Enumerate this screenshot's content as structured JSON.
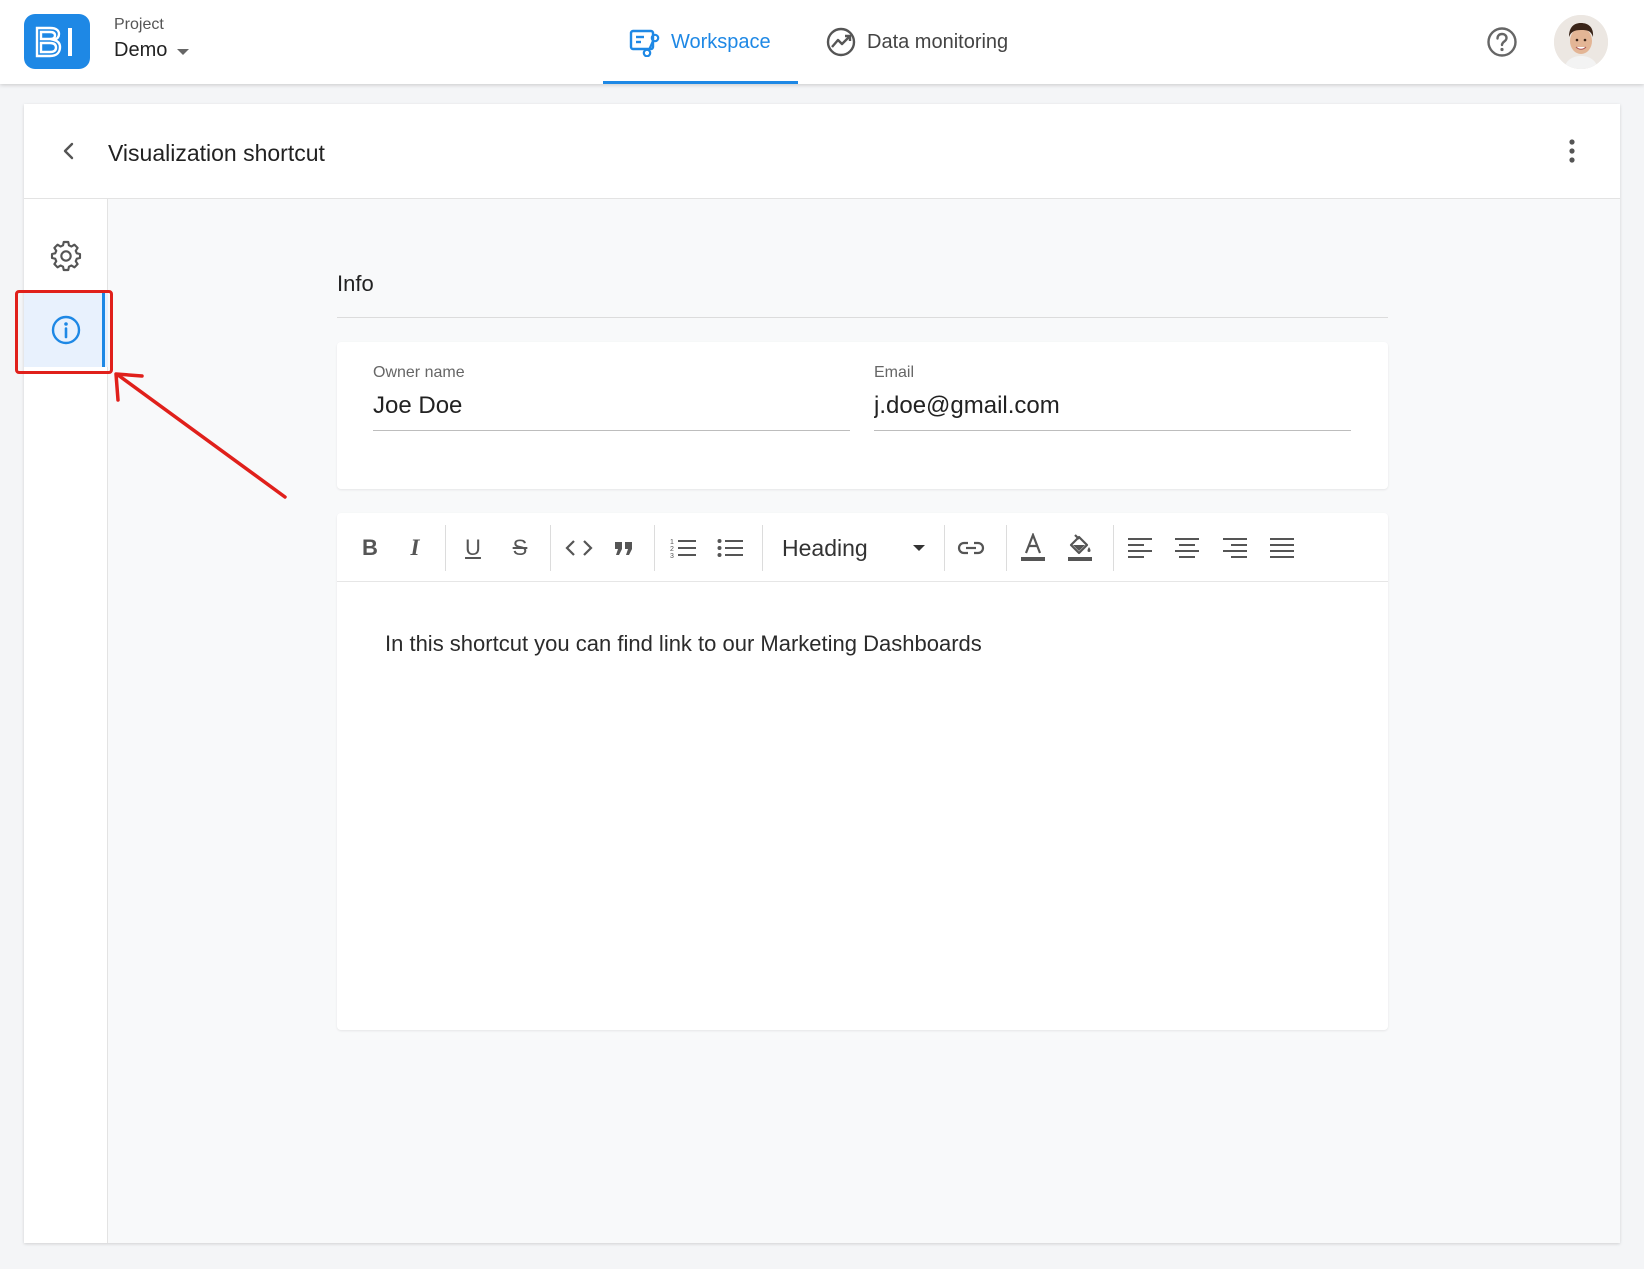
{
  "topbar": {
    "logo_text": "BI",
    "project_label": "Project",
    "project_name": "Demo",
    "tabs": [
      {
        "label": "Workspace",
        "active": true,
        "icon": "workspace-icon"
      },
      {
        "label": "Data monitoring",
        "active": false,
        "icon": "monitoring-chart-icon"
      }
    ],
    "help_icon": "help-circle-icon",
    "avatar_icon": "user-avatar"
  },
  "page": {
    "title": "Visualization shortcut",
    "back_icon": "chevron-left-icon",
    "menu_icon": "more-vertical-icon"
  },
  "sidebar": {
    "items": [
      {
        "name": "settings",
        "icon": "gear-icon",
        "active": false
      },
      {
        "name": "info",
        "icon": "info-icon",
        "active": true
      }
    ]
  },
  "info": {
    "section_title": "Info",
    "owner_label": "Owner name",
    "owner_value": "Joe Doe",
    "email_label": "Email",
    "email_value": "j.doe@gmail.com"
  },
  "editor": {
    "toolbar": {
      "bold": "B",
      "italic": "I",
      "underline": "U",
      "strikethrough": "S",
      "heading_select": "Heading"
    },
    "content": "In this shortcut you can find link to our Marketing Dashboards"
  },
  "colors": {
    "accent": "#1e88e5",
    "annotation": "#e0201b"
  }
}
